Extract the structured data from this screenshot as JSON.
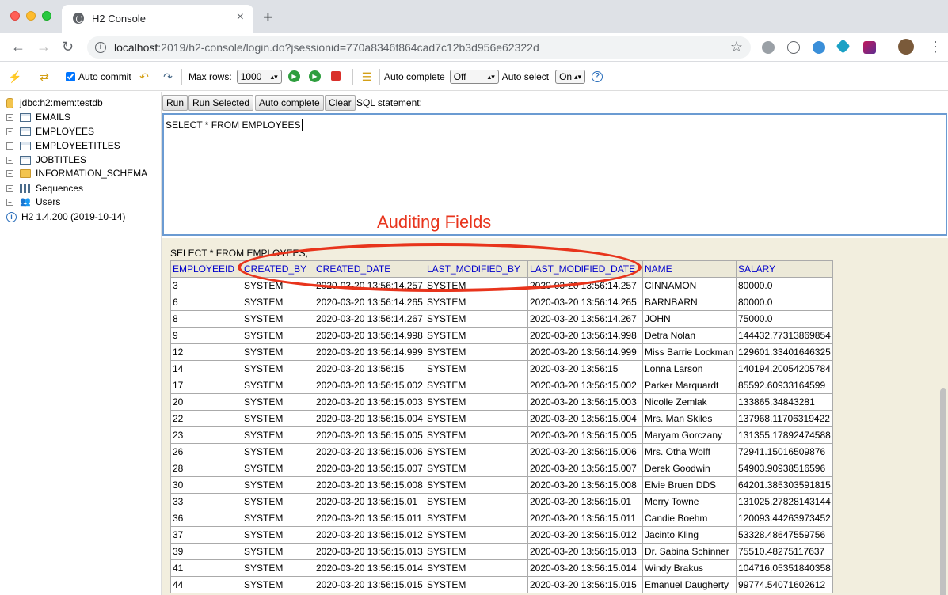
{
  "browser": {
    "tab_title": "H2 Console",
    "tab_close": "×",
    "new_tab": "+",
    "url_host": "localhost",
    "url_path": ":2019/h2-console/login.do?jsessionid=770a8346f864cad7c12b3d956e62322d"
  },
  "toolbar": {
    "auto_commit_label": "Auto commit",
    "max_rows_label": "Max rows:",
    "max_rows_value": "1000",
    "auto_complete_label": "Auto complete",
    "auto_complete_value": "Off",
    "auto_select_label": "Auto select",
    "auto_select_value": "On"
  },
  "sidebar": {
    "connection": "jdbc:h2:mem:testdb",
    "items": [
      {
        "label": "EMAILS",
        "icon": "table-icon"
      },
      {
        "label": "EMPLOYEES",
        "icon": "table-icon"
      },
      {
        "label": "EMPLOYEETITLES",
        "icon": "table-icon"
      },
      {
        "label": "JOBTITLES",
        "icon": "table-icon"
      },
      {
        "label": "INFORMATION_SCHEMA",
        "icon": "folder-icon"
      },
      {
        "label": "Sequences",
        "icon": "sequence-icon"
      },
      {
        "label": "Users",
        "icon": "users-icon"
      }
    ],
    "version": "H2 1.4.200 (2019-10-14)"
  },
  "editor": {
    "run_label": "Run",
    "run_selected_label": "Run Selected",
    "auto_complete_btn": "Auto complete",
    "clear_label": "Clear",
    "sql_statement_label": "SQL statement:",
    "sql_text": "SELECT * FROM EMPLOYEES"
  },
  "annotation": {
    "label": "Auditing Fields",
    "color": "#e8341c"
  },
  "results": {
    "query": "SELECT * FROM EMPLOYEES;",
    "columns": [
      "EMPLOYEEID",
      "CREATED_BY",
      "CREATED_DATE",
      "LAST_MODIFIED_BY",
      "LAST_MODIFIED_DATE",
      "NAME",
      "SALARY"
    ],
    "rows": [
      [
        "3",
        "SYSTEM",
        "2020-03-20 13:56:14.257",
        "SYSTEM",
        "2020-03-20 13:56:14.257",
        "CINNAMON",
        "80000.0"
      ],
      [
        "6",
        "SYSTEM",
        "2020-03-20 13:56:14.265",
        "SYSTEM",
        "2020-03-20 13:56:14.265",
        "BARNBARN",
        "80000.0"
      ],
      [
        "8",
        "SYSTEM",
        "2020-03-20 13:56:14.267",
        "SYSTEM",
        "2020-03-20 13:56:14.267",
        "JOHN",
        "75000.0"
      ],
      [
        "9",
        "SYSTEM",
        "2020-03-20 13:56:14.998",
        "SYSTEM",
        "2020-03-20 13:56:14.998",
        "Detra Nolan",
        "144432.77313869854"
      ],
      [
        "12",
        "SYSTEM",
        "2020-03-20 13:56:14.999",
        "SYSTEM",
        "2020-03-20 13:56:14.999",
        "Miss Barrie Lockman",
        "129601.33401646325"
      ],
      [
        "14",
        "SYSTEM",
        "2020-03-20 13:56:15",
        "SYSTEM",
        "2020-03-20 13:56:15",
        "Lonna Larson",
        "140194.20054205784"
      ],
      [
        "17",
        "SYSTEM",
        "2020-03-20 13:56:15.002",
        "SYSTEM",
        "2020-03-20 13:56:15.002",
        "Parker Marquardt",
        "85592.60933164599"
      ],
      [
        "20",
        "SYSTEM",
        "2020-03-20 13:56:15.003",
        "SYSTEM",
        "2020-03-20 13:56:15.003",
        "Nicolle Zemlak",
        "133865.34843281"
      ],
      [
        "22",
        "SYSTEM",
        "2020-03-20 13:56:15.004",
        "SYSTEM",
        "2020-03-20 13:56:15.004",
        "Mrs. Man Skiles",
        "137968.11706319422"
      ],
      [
        "23",
        "SYSTEM",
        "2020-03-20 13:56:15.005",
        "SYSTEM",
        "2020-03-20 13:56:15.005",
        "Maryam Gorczany",
        "131355.17892474588"
      ],
      [
        "26",
        "SYSTEM",
        "2020-03-20 13:56:15.006",
        "SYSTEM",
        "2020-03-20 13:56:15.006",
        "Mrs. Otha Wolff",
        "72941.15016509876"
      ],
      [
        "28",
        "SYSTEM",
        "2020-03-20 13:56:15.007",
        "SYSTEM",
        "2020-03-20 13:56:15.007",
        "Derek Goodwin",
        "54903.90938516596"
      ],
      [
        "30",
        "SYSTEM",
        "2020-03-20 13:56:15.008",
        "SYSTEM",
        "2020-03-20 13:56:15.008",
        "Elvie Bruen DDS",
        "64201.385303591815"
      ],
      [
        "33",
        "SYSTEM",
        "2020-03-20 13:56:15.01",
        "SYSTEM",
        "2020-03-20 13:56:15.01",
        "Merry Towne",
        "131025.27828143144"
      ],
      [
        "36",
        "SYSTEM",
        "2020-03-20 13:56:15.011",
        "SYSTEM",
        "2020-03-20 13:56:15.011",
        "Candie Boehm",
        "120093.44263973452"
      ],
      [
        "37",
        "SYSTEM",
        "2020-03-20 13:56:15.012",
        "SYSTEM",
        "2020-03-20 13:56:15.012",
        "Jacinto Kling",
        "53328.48647559756"
      ],
      [
        "39",
        "SYSTEM",
        "2020-03-20 13:56:15.013",
        "SYSTEM",
        "2020-03-20 13:56:15.013",
        "Dr. Sabina Schinner",
        "75510.48275117637"
      ],
      [
        "41",
        "SYSTEM",
        "2020-03-20 13:56:15.014",
        "SYSTEM",
        "2020-03-20 13:56:15.014",
        "Windy Brakus",
        "104716.05351840358"
      ],
      [
        "44",
        "SYSTEM",
        "2020-03-20 13:56:15.015",
        "SYSTEM",
        "2020-03-20 13:56:15.015",
        "Emanuel Daugherty",
        "99774.54071602612"
      ]
    ]
  }
}
